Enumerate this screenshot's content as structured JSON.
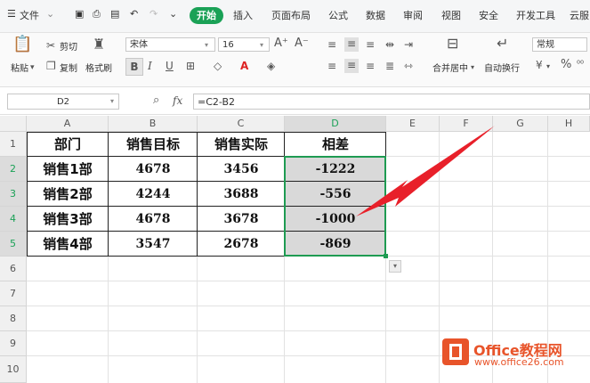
{
  "menubar": {
    "items": [
      "文件",
      "开始",
      "插入",
      "页面布局",
      "公式",
      "数据",
      "审阅",
      "视图",
      "安全",
      "开发工具",
      "云服"
    ],
    "active": "开始"
  },
  "ribbon": {
    "paste": "粘贴",
    "cut": "剪切",
    "copy": "复制",
    "format_painter": "格式刷",
    "font_name": "宋体",
    "font_size": "16",
    "bold": "B",
    "italic": "I",
    "underline": "U",
    "merge_center": "合并居中",
    "auto_wrap": "自动换行",
    "number_format": "常规",
    "percent": "%"
  },
  "formula_bar": {
    "name_box": "D2",
    "fx": "fx",
    "formula": "=C2-B2"
  },
  "sheet": {
    "columns": [
      "A",
      "B",
      "C",
      "D",
      "E",
      "F",
      "G",
      "H"
    ],
    "rows": [
      "1",
      "2",
      "3",
      "4",
      "5",
      "6",
      "7",
      "8",
      "9",
      "10"
    ],
    "header": [
      "部门",
      "销售目标",
      "销售实际",
      "相差"
    ],
    "data": [
      [
        "销售1部",
        "4678",
        "3456",
        "-1222"
      ],
      [
        "销售2部",
        "4244",
        "3688",
        "-556"
      ],
      [
        "销售3部",
        "4678",
        "3678",
        "-1000"
      ],
      [
        "销售4部",
        "3547",
        "2678",
        "-869"
      ]
    ]
  },
  "watermark": {
    "title": "Office教程网",
    "url": "www.office26.com"
  },
  "colors": {
    "accent": "#1aa156",
    "arrow": "#e8202a",
    "selection_border": "#1e9b52",
    "logo": "#e8542a"
  }
}
